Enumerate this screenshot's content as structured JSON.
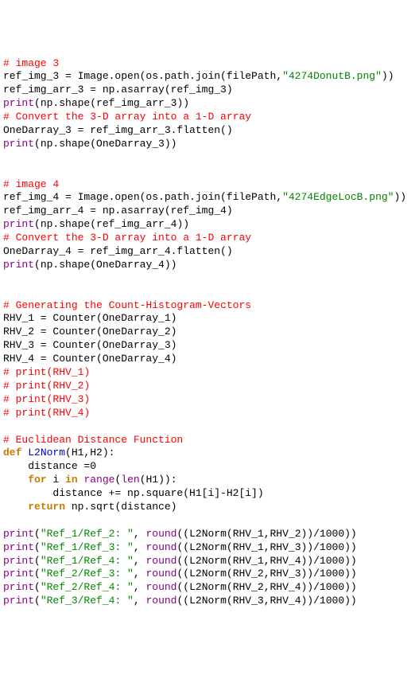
{
  "lines": [
    {
      "parts": [
        {
          "cls": "k-comment",
          "text": "# image 3"
        }
      ]
    },
    {
      "parts": [
        {
          "cls": "k-text",
          "text": "ref_img_3 = Image.open(os.path.join(filePath,"
        },
        {
          "cls": "k-string",
          "text": "\"4274DonutB.png\""
        },
        {
          "cls": "k-text",
          "text": "))"
        }
      ]
    },
    {
      "parts": [
        {
          "cls": "k-text",
          "text": "ref_img_arr_3 = np.asarray(ref_img_3)"
        }
      ]
    },
    {
      "parts": [
        {
          "cls": "k-builtin",
          "text": "print"
        },
        {
          "cls": "k-text",
          "text": "(np.shape(ref_img_arr_3))"
        }
      ]
    },
    {
      "parts": [
        {
          "cls": "k-comment",
          "text": "# Convert the 3-D array into a 1-D array"
        }
      ]
    },
    {
      "parts": [
        {
          "cls": "k-text",
          "text": "OneDarray_3 = ref_img_arr_3.flatten()"
        }
      ]
    },
    {
      "parts": [
        {
          "cls": "k-builtin",
          "text": "print"
        },
        {
          "cls": "k-text",
          "text": "(np.shape(OneDarray_3))"
        }
      ]
    },
    {
      "parts": [
        {
          "cls": "k-text",
          "text": ""
        }
      ]
    },
    {
      "parts": [
        {
          "cls": "k-text",
          "text": ""
        }
      ]
    },
    {
      "parts": [
        {
          "cls": "k-comment",
          "text": "# image 4"
        }
      ]
    },
    {
      "parts": [
        {
          "cls": "k-text",
          "text": "ref_img_4 = Image.open(os.path.join(filePath,"
        },
        {
          "cls": "k-string",
          "text": "\"4274EdgeLocB.png\""
        },
        {
          "cls": "k-text",
          "text": "))"
        }
      ]
    },
    {
      "parts": [
        {
          "cls": "k-text",
          "text": "ref_img_arr_4 = np.asarray(ref_img_4)"
        }
      ]
    },
    {
      "parts": [
        {
          "cls": "k-builtin",
          "text": "print"
        },
        {
          "cls": "k-text",
          "text": "(np.shape(ref_img_arr_4))"
        }
      ]
    },
    {
      "parts": [
        {
          "cls": "k-comment",
          "text": "# Convert the 3-D array into a 1-D array"
        }
      ]
    },
    {
      "parts": [
        {
          "cls": "k-text",
          "text": "OneDarray_4 = ref_img_arr_4.flatten()"
        }
      ]
    },
    {
      "parts": [
        {
          "cls": "k-builtin",
          "text": "print"
        },
        {
          "cls": "k-text",
          "text": "(np.shape(OneDarray_4))"
        }
      ]
    },
    {
      "parts": [
        {
          "cls": "k-text",
          "text": ""
        }
      ]
    },
    {
      "parts": [
        {
          "cls": "k-text",
          "text": ""
        }
      ]
    },
    {
      "parts": [
        {
          "cls": "k-comment",
          "text": "# Generating the Count-Histogram-Vectors"
        }
      ]
    },
    {
      "parts": [
        {
          "cls": "k-text",
          "text": "RHV_1 = Counter(OneDarray_1)"
        }
      ]
    },
    {
      "parts": [
        {
          "cls": "k-text",
          "text": "RHV_2 = Counter(OneDarray_2)"
        }
      ]
    },
    {
      "parts": [
        {
          "cls": "k-text",
          "text": "RHV_3 = Counter(OneDarray_3)"
        }
      ]
    },
    {
      "parts": [
        {
          "cls": "k-text",
          "text": "RHV_4 = Counter(OneDarray_4)"
        }
      ]
    },
    {
      "parts": [
        {
          "cls": "k-comment",
          "text": "# print(RHV_1)"
        }
      ]
    },
    {
      "parts": [
        {
          "cls": "k-comment",
          "text": "# print(RHV_2)"
        }
      ]
    },
    {
      "parts": [
        {
          "cls": "k-comment",
          "text": "# print(RHV_3)"
        }
      ]
    },
    {
      "parts": [
        {
          "cls": "k-comment",
          "text": "# print(RHV_4)"
        }
      ]
    },
    {
      "parts": [
        {
          "cls": "k-text",
          "text": ""
        }
      ]
    },
    {
      "parts": [
        {
          "cls": "k-comment",
          "text": "# Euclidean Distance Function"
        }
      ]
    },
    {
      "parts": [
        {
          "cls": "k-keyword",
          "text": "def"
        },
        {
          "cls": "k-text",
          "text": " "
        },
        {
          "cls": "k-func",
          "text": "L2Norm"
        },
        {
          "cls": "k-text",
          "text": "(H1,H2):"
        }
      ]
    },
    {
      "parts": [
        {
          "cls": "k-text",
          "text": "    distance =0"
        }
      ]
    },
    {
      "parts": [
        {
          "cls": "k-text",
          "text": "    "
        },
        {
          "cls": "k-keyword",
          "text": "for"
        },
        {
          "cls": "k-text",
          "text": " i "
        },
        {
          "cls": "k-keyword",
          "text": "in"
        },
        {
          "cls": "k-text",
          "text": " "
        },
        {
          "cls": "k-builtin",
          "text": "range"
        },
        {
          "cls": "k-text",
          "text": "("
        },
        {
          "cls": "k-builtin",
          "text": "len"
        },
        {
          "cls": "k-text",
          "text": "(H1)):"
        }
      ]
    },
    {
      "parts": [
        {
          "cls": "k-text",
          "text": "        distance += np.square(H1[i]-H2[i])"
        }
      ]
    },
    {
      "parts": [
        {
          "cls": "k-text",
          "text": "    "
        },
        {
          "cls": "k-keyword",
          "text": "return"
        },
        {
          "cls": "k-text",
          "text": " np.sqrt(distance)"
        }
      ]
    },
    {
      "parts": [
        {
          "cls": "k-text",
          "text": ""
        }
      ]
    },
    {
      "parts": [
        {
          "cls": "k-builtin",
          "text": "print"
        },
        {
          "cls": "k-text",
          "text": "("
        },
        {
          "cls": "k-string",
          "text": "\"Ref_1/Ref_2: \""
        },
        {
          "cls": "k-text",
          "text": ", "
        },
        {
          "cls": "k-builtin",
          "text": "round"
        },
        {
          "cls": "k-text",
          "text": "((L2Norm(RHV_1,RHV_2))/1000))"
        }
      ]
    },
    {
      "parts": [
        {
          "cls": "k-builtin",
          "text": "print"
        },
        {
          "cls": "k-text",
          "text": "("
        },
        {
          "cls": "k-string",
          "text": "\"Ref_1/Ref_3: \""
        },
        {
          "cls": "k-text",
          "text": ", "
        },
        {
          "cls": "k-builtin",
          "text": "round"
        },
        {
          "cls": "k-text",
          "text": "((L2Norm(RHV_1,RHV_3))/1000))"
        }
      ]
    },
    {
      "parts": [
        {
          "cls": "k-builtin",
          "text": "print"
        },
        {
          "cls": "k-text",
          "text": "("
        },
        {
          "cls": "k-string",
          "text": "\"Ref_1/Ref_4: \""
        },
        {
          "cls": "k-text",
          "text": ", "
        },
        {
          "cls": "k-builtin",
          "text": "round"
        },
        {
          "cls": "k-text",
          "text": "((L2Norm(RHV_1,RHV_4))/1000))"
        }
      ]
    },
    {
      "parts": [
        {
          "cls": "k-builtin",
          "text": "print"
        },
        {
          "cls": "k-text",
          "text": "("
        },
        {
          "cls": "k-string",
          "text": "\"Ref_2/Ref_3: \""
        },
        {
          "cls": "k-text",
          "text": ", "
        },
        {
          "cls": "k-builtin",
          "text": "round"
        },
        {
          "cls": "k-text",
          "text": "((L2Norm(RHV_2,RHV_3))/1000))"
        }
      ]
    },
    {
      "parts": [
        {
          "cls": "k-builtin",
          "text": "print"
        },
        {
          "cls": "k-text",
          "text": "("
        },
        {
          "cls": "k-string",
          "text": "\"Ref_2/Ref_4: \""
        },
        {
          "cls": "k-text",
          "text": ", "
        },
        {
          "cls": "k-builtin",
          "text": "round"
        },
        {
          "cls": "k-text",
          "text": "((L2Norm(RHV_2,RHV_4))/1000))"
        }
      ]
    },
    {
      "parts": [
        {
          "cls": "k-builtin",
          "text": "print"
        },
        {
          "cls": "k-text",
          "text": "("
        },
        {
          "cls": "k-string",
          "text": "\"Ref_3/Ref_4: \""
        },
        {
          "cls": "k-text",
          "text": ", "
        },
        {
          "cls": "k-builtin",
          "text": "round"
        },
        {
          "cls": "k-text",
          "text": "((L2Norm(RHV_3,RHV_4))/1000))"
        }
      ]
    }
  ]
}
